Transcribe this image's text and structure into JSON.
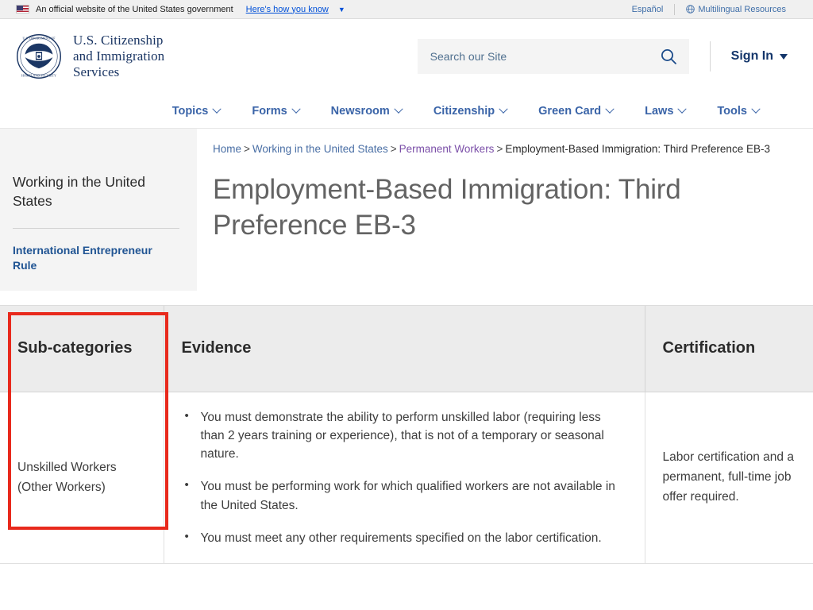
{
  "gov_banner": {
    "flag_icon": "us-flag-icon",
    "text": "An official website of the United States government",
    "howto_label": "Here's how you know",
    "caret_icon": "chevron-down-icon",
    "espanol_label": "Español",
    "globe_icon": "globe-icon",
    "multilingual_label": "Multilingual Resources"
  },
  "header": {
    "seal_icon": "dhs-seal-icon",
    "brand_line1": "U.S. Citizenship",
    "brand_line2": "and Immigration",
    "brand_line3": "Services",
    "search": {
      "placeholder": "Search our Site",
      "value": "",
      "icon": "search-icon"
    },
    "signin_label": "Sign In",
    "signin_caret_icon": "caret-down-icon"
  },
  "nav": {
    "items": [
      {
        "label": "Topics",
        "icon": "chevron-down-icon"
      },
      {
        "label": "Forms",
        "icon": "chevron-down-icon"
      },
      {
        "label": "Newsroom",
        "icon": "chevron-down-icon"
      },
      {
        "label": "Citizenship",
        "icon": "chevron-down-icon"
      },
      {
        "label": "Green Card",
        "icon": "chevron-down-icon"
      },
      {
        "label": "Laws",
        "icon": "chevron-down-icon"
      },
      {
        "label": "Tools",
        "icon": "chevron-down-icon"
      }
    ]
  },
  "sidebar": {
    "title": "Working in the United States",
    "links": [
      {
        "label": "International Entrepreneur Rule"
      }
    ]
  },
  "breadcrumb": {
    "items": [
      {
        "label": "Home",
        "type": "link"
      },
      {
        "label": "Working in the United States",
        "type": "link"
      },
      {
        "label": "Permanent Workers",
        "type": "visited"
      },
      {
        "label": "Employment-Based Immigration: Third Preference EB-3",
        "type": "current"
      }
    ],
    "separator": ">"
  },
  "page": {
    "title": "Employment-Based Immigration: Third Preference EB-3"
  },
  "table": {
    "headers": [
      "Sub-categories",
      "Evidence",
      "Certification"
    ],
    "rows": [
      {
        "subcategory": "Unskilled Workers (Other Workers)",
        "evidence": [
          "You must demonstrate the ability to perform unskilled labor (requiring less than 2 years training or experience), that is not of a temporary or seasonal nature.",
          "You must be performing work for which qualified workers are not available in the United States.",
          "You must meet any other requirements specified on the labor certification."
        ],
        "certification": "Labor certification and a permanent, full-time job offer required."
      }
    ]
  },
  "annotation": {
    "highlight_color": "#e8291c",
    "target": "subcategory-cell-unskilled-workers"
  }
}
